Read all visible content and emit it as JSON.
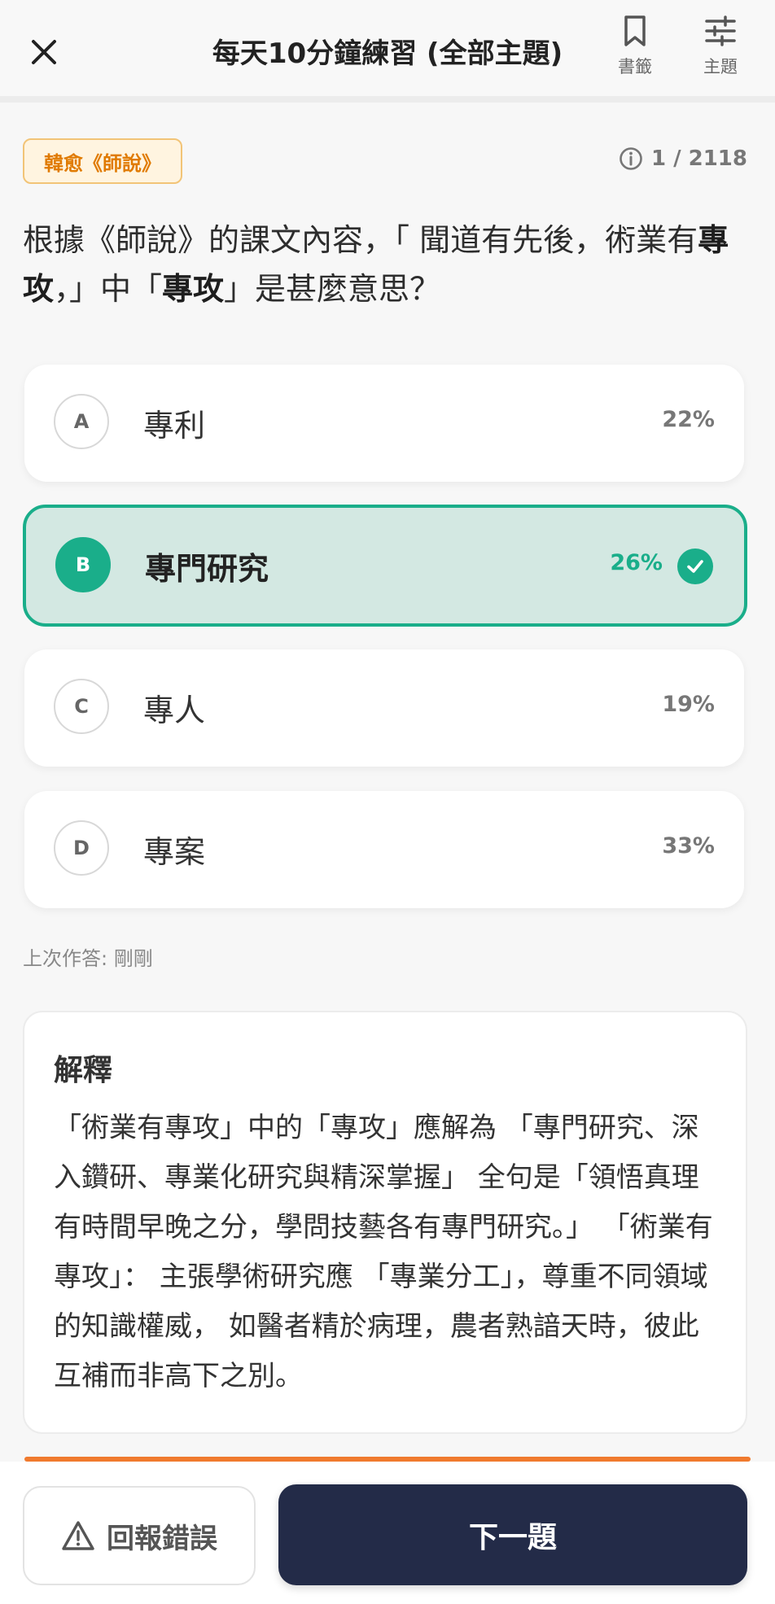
{
  "header": {
    "title": "每天10分鐘練習 (全部主題)",
    "bookmark_label": "書籤",
    "topics_label": "主題"
  },
  "tag": "韓愈《師說》",
  "counter": "1 / 2118",
  "question": {
    "part1": "根據《師說》的課文內容，「 聞道有先後，術業有",
    "bold1": "專攻",
    "part2": "，」中「",
    "bold2": "專攻",
    "part3": "」是甚麼意思？"
  },
  "options": [
    {
      "letter": "A",
      "text": "專利",
      "percent": "22%"
    },
    {
      "letter": "B",
      "text": "專門研究",
      "percent": "26%"
    },
    {
      "letter": "C",
      "text": "專人",
      "percent": "19%"
    },
    {
      "letter": "D",
      "text": "專案",
      "percent": "33%"
    }
  ],
  "correct_option": "B",
  "last_answer": "上次作答: 剛剛",
  "explanation": {
    "title": "解釋",
    "body": "「術業有專攻」中的「專攻」應解為 「專門研究、深入鑽研、專業化研究與精深掌握」 全句是「領悟真理有時間早晚之分，學問技藝各有專門研究。」 「術業有專攻」： 主張學術研究應 「專業分工」，尊重不同領域的知識權威， 如醫者精於病理，農者熟諳天時，彼此互補而非高下之別。"
  },
  "buttons": {
    "report": "回報錯誤",
    "next": "下一題"
  },
  "colors": {
    "accent_green": "#1aae8a",
    "tag_orange": "#e07a00",
    "next_button": "#232b48"
  }
}
